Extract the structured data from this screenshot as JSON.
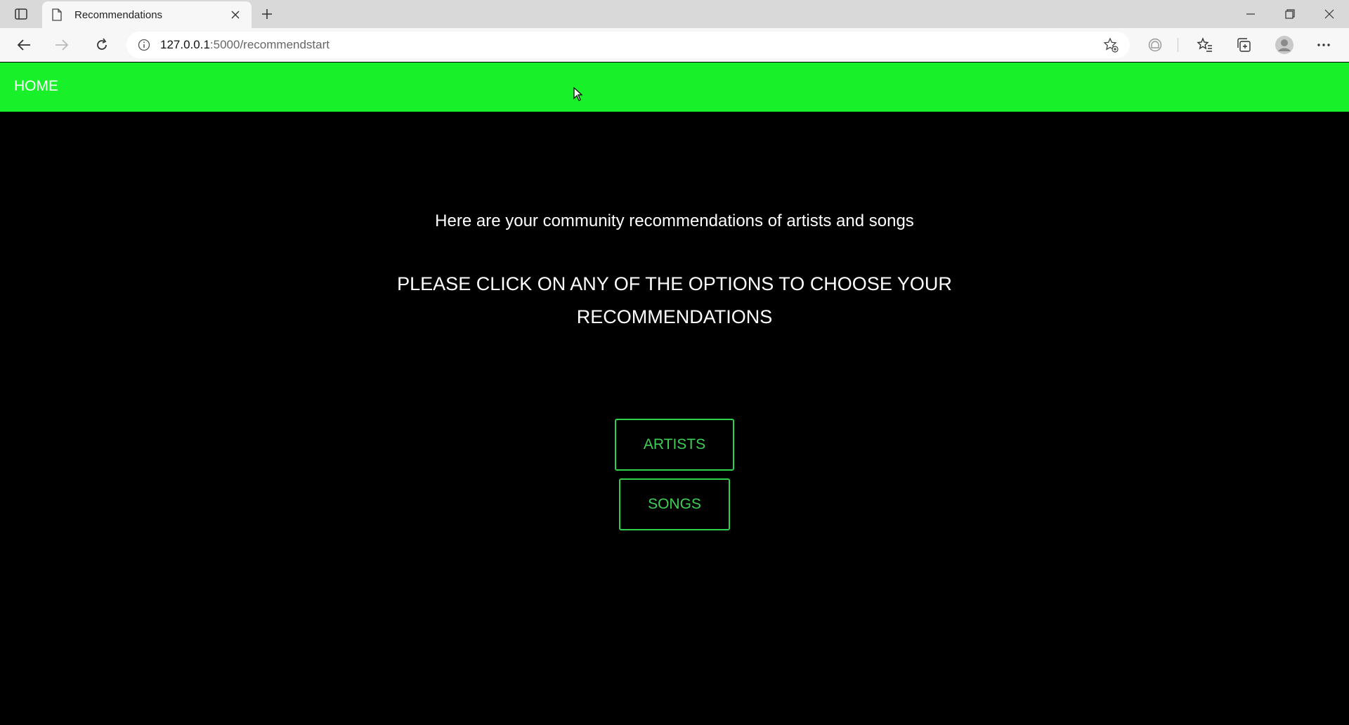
{
  "browser": {
    "tab_title": "Recommendations",
    "url_host": "127.0.0.1",
    "url_path": ":5000/recommendstart",
    "icons": [
      "tab-actions-icon",
      "page-icon",
      "close-icon",
      "plus-icon",
      "minimize-icon",
      "restore-icon",
      "close-window-icon",
      "back-icon",
      "forward-icon",
      "refresh-icon",
      "info-icon",
      "add-favorite-icon",
      "tracking-icon",
      "favorites-icon",
      "collections-icon",
      "profile-avatar",
      "more-icon"
    ]
  },
  "nav": {
    "home_label": "HOME",
    "color": "#18f02a"
  },
  "main": {
    "subtitle": "Here are your community recommendations of artists and songs",
    "headline_line1": "PLEASE CLICK ON ANY OF THE OPTIONS TO CHOOSE YOUR",
    "headline_line2": "RECOMMENDATIONS",
    "buttons": [
      {
        "label": "ARTISTS"
      },
      {
        "label": "SONGS"
      }
    ],
    "button_color": "#3ccf55"
  }
}
